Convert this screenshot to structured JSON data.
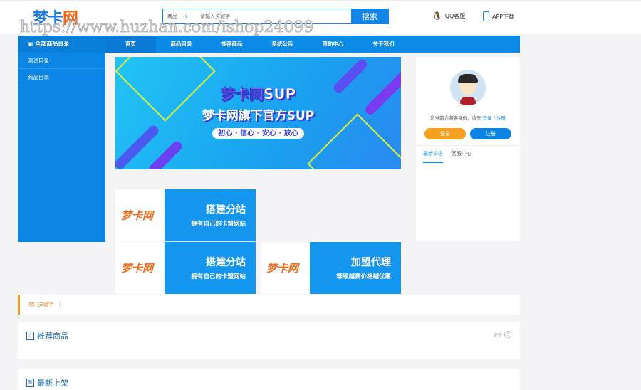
{
  "header": {
    "logo_main": "梦卡",
    "logo_accent": "网",
    "watermark": "https://www.huzhan.com/ishop24099",
    "search_category": "商品",
    "search_placeholder": "请输入关键字",
    "search_button": "搜索",
    "qq_service": "QQ客服",
    "app_download": "APP下载"
  },
  "sidebar": {
    "title": "全部商品目录",
    "items": [
      "测试目录",
      "商品目录"
    ]
  },
  "nav": [
    "首页",
    "商品目录",
    "推荐商品",
    "系统公告",
    "帮助中心",
    "关于我们"
  ],
  "banner": {
    "line1": "梦卡网SUP",
    "line2": "梦卡网旗下官方SUP",
    "line3": "初心 · 信心 · 安心 · 放心"
  },
  "ads": [
    {
      "brand": "梦卡网",
      "headline": "搭建分站",
      "sub": "拥有自己的卡盟网站"
    },
    {
      "brand": "梦卡网",
      "headline": "搭建分站",
      "sub": "拥有自己的卡盟网站"
    },
    {
      "brand": "梦卡网",
      "headline": "加盟代理",
      "sub": "等级越高价格越优惠"
    }
  ],
  "user_panel": {
    "guest_text": "您当前为游客身份，请先",
    "login_link": "登录",
    "sep": "/",
    "register_link": "注册",
    "login_button": "登录",
    "register_button": "注册",
    "tabs": [
      "最新公告",
      "客服中心"
    ]
  },
  "hot_keywords": {
    "label": "热门关键字"
  },
  "recommended": {
    "icon": "☆",
    "title": "推荐商品",
    "more": "更多"
  },
  "latest": {
    "icon": "新",
    "title": "最新上架"
  },
  "colors": {
    "primary": "#0b86e6",
    "orange": "#f5a01e"
  }
}
